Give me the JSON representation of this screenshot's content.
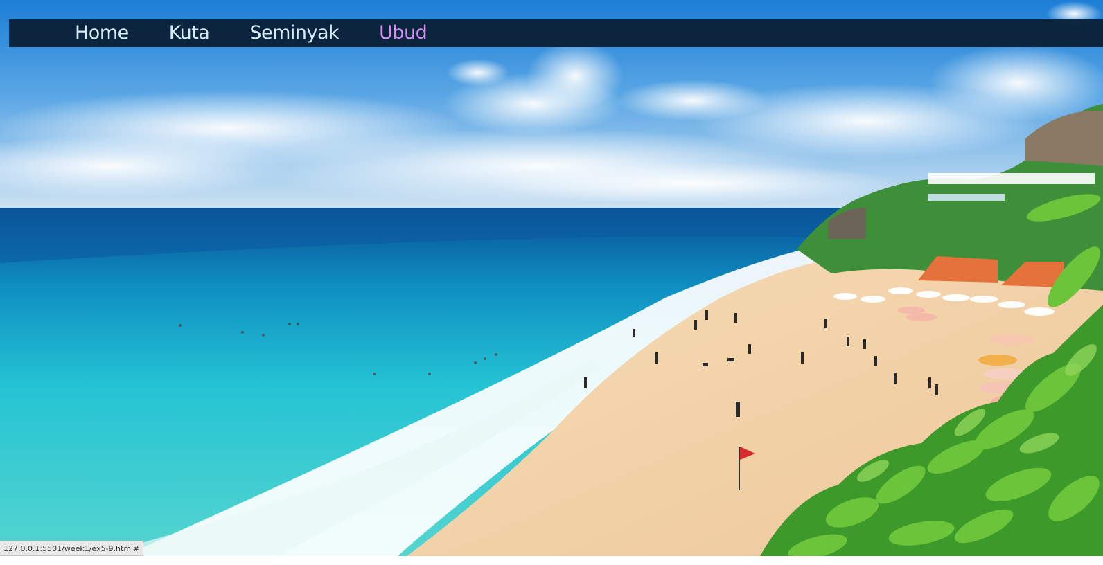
{
  "nav": {
    "items": [
      {
        "label": "Home",
        "active": false
      },
      {
        "label": "Kuta",
        "active": false
      },
      {
        "label": "Seminyak",
        "active": false
      },
      {
        "label": "Ubud",
        "active": true
      }
    ],
    "colors": {
      "background": "#0a1e34",
      "link": "#d8ecf8",
      "active_link": "#d98ff2"
    }
  },
  "hero": {
    "subject": "beach-photo"
  },
  "status_bar": {
    "url": "127.0.0.1:5501/week1/ex5-9.html#"
  }
}
